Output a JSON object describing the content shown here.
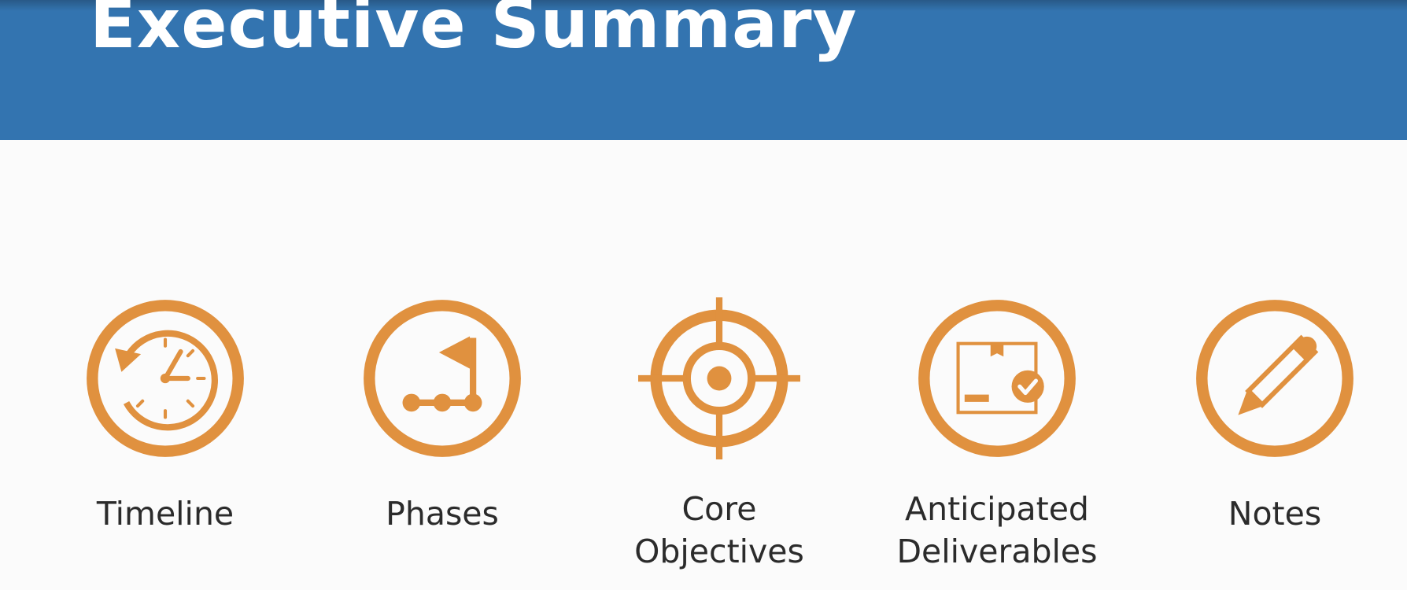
{
  "header": {
    "title": "Executive Summary"
  },
  "colors": {
    "header_background": "#3374b0",
    "accent_orange": "#e0913f",
    "title_text": "#ffffff",
    "label_text": "#2b2b2b"
  },
  "items": [
    {
      "label": "Timeline",
      "icon": "clock-history-icon"
    },
    {
      "label": "Phases",
      "icon": "flag-milestones-icon"
    },
    {
      "label": "Core\nObjectives",
      "icon": "target-crosshair-icon"
    },
    {
      "label": "Anticipated\nDeliverables",
      "icon": "package-check-icon"
    },
    {
      "label": "Notes",
      "icon": "pencil-icon"
    }
  ]
}
